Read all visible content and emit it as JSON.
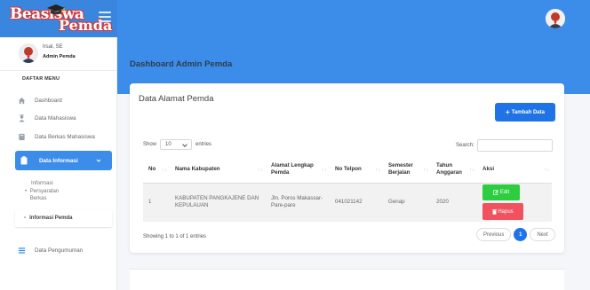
{
  "brand": {
    "line1": "Beasiswa",
    "line2": "Pemda"
  },
  "profile": {
    "name": "Irsal, SE",
    "role": "Admin Pemda"
  },
  "sidebar": {
    "menu_header": "DAFTAR MENU",
    "items": [
      {
        "label": "Dashboard",
        "icon": "home-icon"
      },
      {
        "label": "Data Mahasiswa",
        "icon": "user-graduate-icon"
      },
      {
        "label": "Data Berkas Mahasiswa",
        "icon": "book-icon"
      },
      {
        "label": "Data Informasi",
        "icon": "clipboard-icon"
      },
      {
        "label": "Data Pengumuman",
        "icon": "list-icon"
      }
    ],
    "sub_items": [
      "Informasi",
      "Persyaratan Berkas",
      "Informasi Pemda"
    ]
  },
  "page": {
    "title": "Dashboard Admin Pemda"
  },
  "card": {
    "title": "Data Alamat Pemda",
    "add_button": "Tambah Data",
    "show_label": "Show",
    "entries_value": "10",
    "entries_label": "entries",
    "search_label": "Search:",
    "search_value": "",
    "columns": [
      "No",
      "Nama Kabupaten",
      "Alamat Lengkap Pemda",
      "No Telpon",
      "Semester Berjalan",
      "Tahun Anggaran",
      "Aksi"
    ],
    "rows": [
      {
        "no": "1",
        "kabupaten": "KABUPATEN PANGKAJENE DAN KEPULAUAN",
        "alamat": "Jln. Poros Makassar-Pare-pare",
        "telpon": "041021142",
        "semester": "Genap",
        "tahun": "2020",
        "edit": "Edit",
        "hapus": "Hapus"
      }
    ],
    "showing": "Showing 1 to 1 of 1 entries",
    "pager": {
      "previous": "Previous",
      "current": "1",
      "next": "Next"
    }
  },
  "colors": {
    "primary": "#3c8dea",
    "button_blue": "#1f73e6",
    "edit_green": "#2ecc40",
    "delete_red": "#f0525f"
  }
}
